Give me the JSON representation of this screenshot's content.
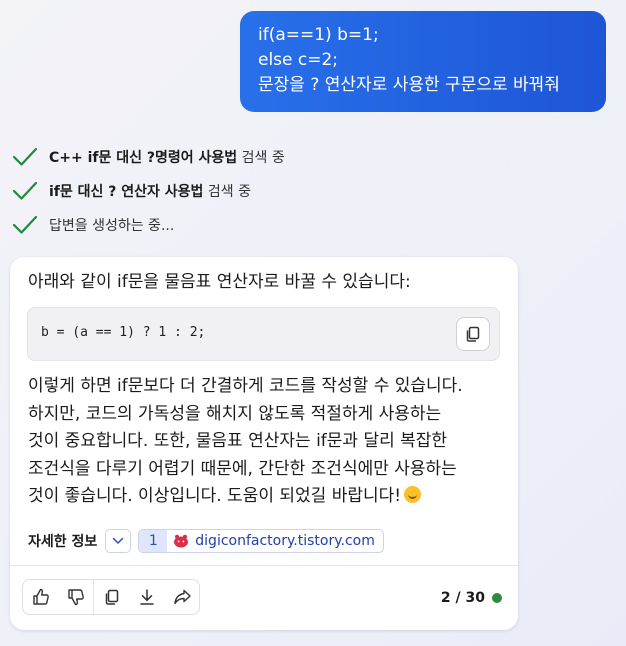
{
  "user_message": {
    "lines": [
      "if(a==1) b=1;",
      "else c=2;",
      "문장을 ? 연산자로 사용한 구문으로 바꿔줘"
    ]
  },
  "search_steps": [
    {
      "bold": "C++ if문 대신 ?명령어 사용법",
      "rest": " 검색 중"
    },
    {
      "bold": "if문 대신 ? 연산자 사용법",
      "rest": " 검색 중"
    },
    {
      "bold": "",
      "rest": "답변을 생성하는 중..."
    }
  ],
  "response": {
    "intro": "아래와 같이 if문을 물음표 연산자로 바꿀 수 있습니다:",
    "code": "b = (a == 1) ? 1 : 2;",
    "body_lines": [
      "이렇게 하면 if문보다 더 간결하게 코드를 작성할 수 있습니다.",
      "하지만, 코드의 가독성을 해치지 않도록 적절하게 사용하는",
      "것이 중요합니다. 또한, 물음표 연산자는 if문과 달리 복잡한",
      "조건식을 다루기 어렵기 때문에, 간단한 조건식에만 사용하는",
      "것이 좋습니다. 이상입니다. 도움이 되었길 바랍니다!"
    ],
    "emoji": "smiling-face-emoji"
  },
  "references": {
    "label": "자세한 정보",
    "items": [
      {
        "num": "1",
        "site": "digiconfactory.tistory.com"
      }
    ]
  },
  "footer": {
    "counter": "2 / 30",
    "status_color": "#2e8b3e"
  },
  "colors": {
    "user_bubble": "#1d55d6",
    "check": "#1e8a3a",
    "link": "#2140a8"
  }
}
